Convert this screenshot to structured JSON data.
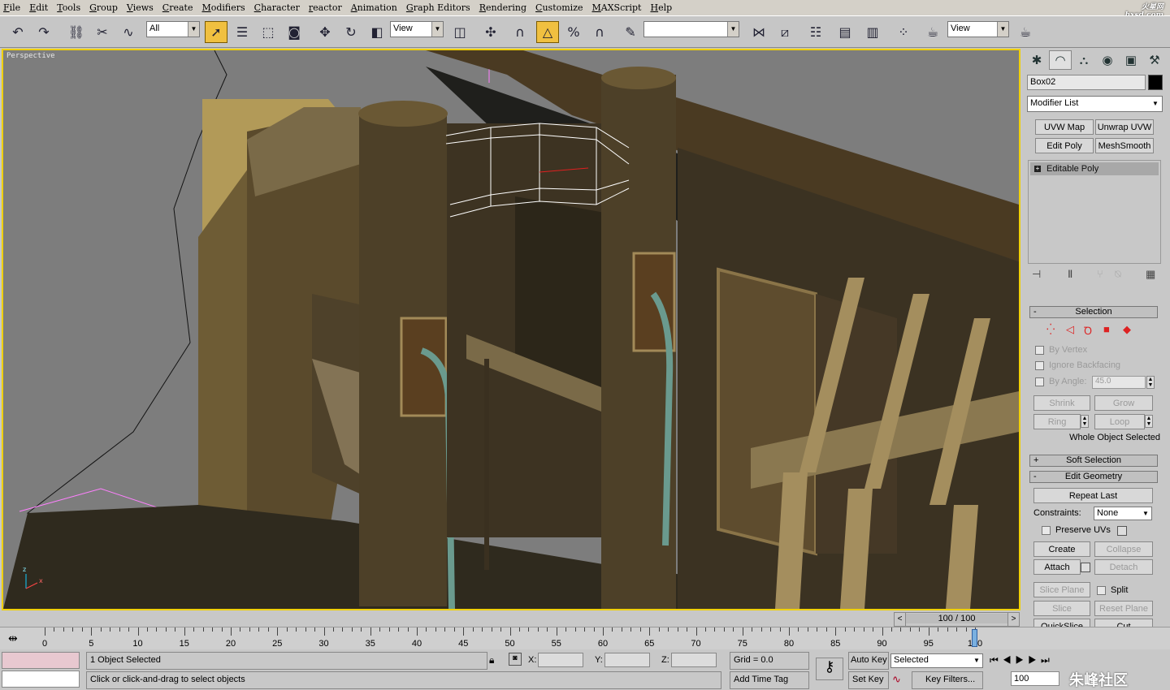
{
  "menu": [
    "File",
    "Edit",
    "Tools",
    "Group",
    "Views",
    "Create",
    "Modifiers",
    "Character",
    "reactor",
    "Animation",
    "Graph Editors",
    "Rendering",
    "Customize",
    "MAXScript",
    "Help"
  ],
  "brand": {
    "logo": "火星网 hxsd.com"
  },
  "toolbar": {
    "undo_icon": "undo-icon",
    "redo_icon": "redo-icon",
    "selection_filter": "All",
    "ref_coord": "View",
    "named_sel": "",
    "view_dropdown": "View"
  },
  "viewport": {
    "label": "Perspective"
  },
  "command_panel": {
    "object_name": "Box02",
    "modifier_list": "Modifier List",
    "modifier_buttons": [
      "UVW Map",
      "Unwrap UVW",
      "Edit Poly",
      "MeshSmooth"
    ],
    "stack_item": "Editable Poly",
    "selection": {
      "title": "Selection",
      "by_vertex": "By Vertex",
      "ignore_backfacing": "Ignore Backfacing",
      "by_angle": "By Angle:",
      "angle_value": "45.0",
      "shrink": "Shrink",
      "grow": "Grow",
      "ring": "Ring",
      "loop": "Loop",
      "status": "Whole Object Selected"
    },
    "soft_selection": "Soft Selection",
    "edit_geometry": {
      "title": "Edit Geometry",
      "repeat_last": "Repeat Last",
      "constraints_label": "Constraints:",
      "constraints_value": "None",
      "preserve_uvs": "Preserve UVs",
      "create": "Create",
      "collapse": "Collapse",
      "attach": "Attach",
      "detach": "Detach",
      "slice_plane": "Slice Plane",
      "split": "Split",
      "slice": "Slice",
      "reset_plane": "Reset Plane",
      "quickslice": "QuickSlice",
      "cut": "Cut"
    }
  },
  "time": {
    "slider": "100 / 100",
    "ticks": [
      "0",
      "5",
      "10",
      "15",
      "20",
      "25",
      "30",
      "35",
      "40",
      "45",
      "50",
      "55",
      "60",
      "65",
      "70",
      "75",
      "80",
      "85",
      "90",
      "95",
      "100"
    ],
    "current_frame": 100,
    "frame_range": [
      0,
      100
    ]
  },
  "status": {
    "selected": "1 Object Selected",
    "prompt": "Click or click-and-drag to select objects",
    "x_label": "X:",
    "y_label": "Y:",
    "z_label": "Z:",
    "grid": "Grid = 0.0",
    "add_time_tag": "Add Time Tag",
    "auto_key": "Auto Key",
    "set_key": "Set Key",
    "key_mode": "Selected",
    "key_filters": "Key Filters...",
    "frame_field": "100",
    "watermark": "朱峰社区"
  }
}
